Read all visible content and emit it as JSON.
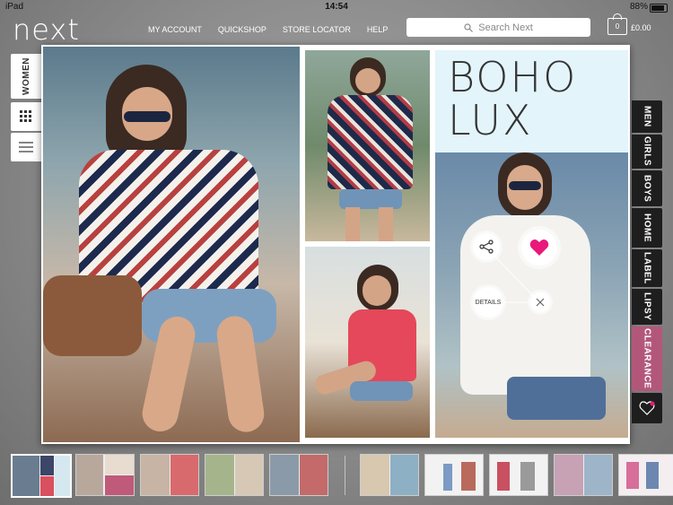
{
  "status_bar": {
    "device": "iPad",
    "time": "14:54",
    "battery": "88%"
  },
  "header": {
    "logo": "next",
    "nav": [
      "MY ACCOUNT",
      "QUICKSHOP",
      "STORE LOCATOR",
      "HELP"
    ],
    "search_placeholder": "Search Next",
    "bag_count": "0",
    "bag_total": "£0.00"
  },
  "left_tabs": {
    "women": "WOMEN"
  },
  "page": {
    "title_line1": "BOHO",
    "title_line2": "LUX",
    "details_label": "DETAILS"
  },
  "right_tabs": [
    "MEN",
    "GIRLS",
    "BOYS",
    "HOME",
    "LABEL",
    "LIPSY",
    "CLEARANCE"
  ],
  "colors": {
    "clearance": "#b3577a",
    "heart": "#e8197a",
    "title_bg": "#e3f4fb"
  }
}
